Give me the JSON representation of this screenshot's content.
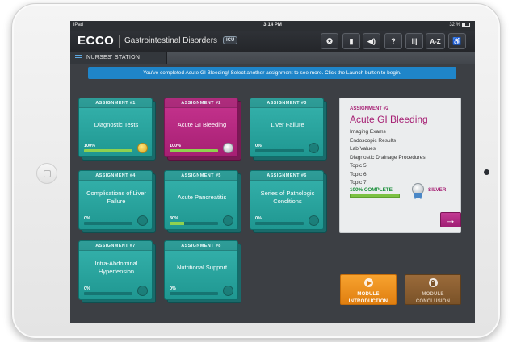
{
  "status_bar": {
    "carrier": "iPad",
    "time": "3:14 PM",
    "battery": "32 %"
  },
  "header": {
    "brand": "ECCO",
    "module_title": "Gastrointestinal Disorders",
    "unit_badge": "ICU",
    "tools": [
      {
        "name": "awards-icon",
        "label": "✪"
      },
      {
        "name": "bookmark-icon",
        "label": "▮"
      },
      {
        "name": "audio-icon",
        "label": "◀)"
      },
      {
        "name": "help-icon",
        "label": "?"
      },
      {
        "name": "library-icon",
        "label": "‖|"
      },
      {
        "name": "glossary-icon",
        "label": "A-Z"
      },
      {
        "name": "accessibility-icon",
        "label": "♿"
      }
    ]
  },
  "nav": {
    "tab_label": "NURSES' STATION"
  },
  "banner": {
    "text": "You've completed Acute GI Bleeding! Select another assignment to see more. Click the Launch button to begin."
  },
  "assignments": [
    {
      "header": "ASSIGNMENT #1",
      "title": "Diagnostic Tests",
      "percent": "100%",
      "progress": 1.0,
      "medal": "gold"
    },
    {
      "header": "ASSIGNMENT #2",
      "title": "Acute GI Bleeding",
      "percent": "100%",
      "progress": 1.0,
      "medal": "silver",
      "selected": true
    },
    {
      "header": "ASSIGNMENT #3",
      "title": "Liver Failure",
      "percent": "0%",
      "progress": 0.0,
      "medal": "none"
    },
    {
      "header": "ASSIGNMENT #4",
      "title": "Complications of Liver Failure",
      "percent": "0%",
      "progress": 0.0,
      "medal": "none"
    },
    {
      "header": "ASSIGNMENT #5",
      "title": "Acute Pancreatitis",
      "percent": "30%",
      "progress": 0.3,
      "medal": "none"
    },
    {
      "header": "ASSIGNMENT #6",
      "title": "Series of Pathologic Conditions",
      "percent": "0%",
      "progress": 0.0,
      "medal": "none"
    },
    {
      "header": "ASSIGNMENT #7",
      "title": "Intra-Abdominal Hypertension",
      "percent": "0%",
      "progress": 0.0,
      "medal": "none"
    },
    {
      "header": "ASSIGNMENT #8",
      "title": "Nutritional Support",
      "percent": "0%",
      "progress": 0.0,
      "medal": "none"
    }
  ],
  "detail": {
    "kicker": "ASSIGNMENT #2",
    "title": "Acute GI Bleeding",
    "topics": [
      "Imaging Exams",
      "Endoscopic Results",
      "Lab Values",
      "Diagnostic Drainage Procedures",
      "Topic 5",
      "Topic 6",
      "Topic 7"
    ],
    "complete_label": "100% COMPLETE",
    "progress": 1.0,
    "medal_label": "SILVER",
    "launch_icon": "→"
  },
  "module_buttons": {
    "intro": {
      "line1": "MODULE",
      "line2": "INTRODUCTION"
    },
    "conclusion": {
      "line1": "MODULE",
      "line2": "CONCLUSION"
    }
  },
  "colors": {
    "accent_teal": "#22a19b",
    "accent_magenta": "#a61f73",
    "banner_blue": "#1f85c9",
    "progress_green": "#8fd14f",
    "intro_orange": "#f29121",
    "conclusion_brown": "#8a5e30"
  }
}
